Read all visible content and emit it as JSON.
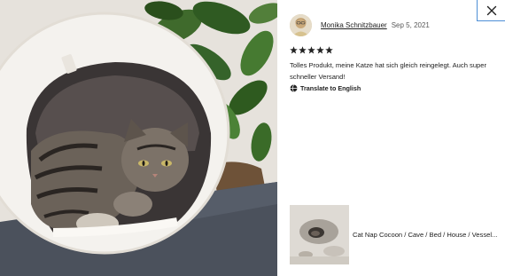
{
  "photo": {
    "alt_icon": "review-photo-cat-in-felt-cave"
  },
  "review": {
    "reviewer_name": "Monika Schnitzbauer",
    "date": "Sep 5, 2021",
    "rating": 5,
    "stars": [
      "★",
      "★",
      "★",
      "★",
      "★"
    ],
    "text": "Tolles Produkt, meine Katze hat sich gleich reingelegt. Auch super schneller Versand!",
    "translate_label": "Translate to English"
  },
  "product": {
    "title": "Cat Nap Cocoon / Cave / Bed / House / Vessel..."
  },
  "icons": {
    "close": "close-icon",
    "translate": "globe-translate-icon",
    "star": "star-icon"
  },
  "colors": {
    "star": "#222222",
    "close_border": "#4d8fd6",
    "text": "#222222",
    "muted": "#595959"
  }
}
